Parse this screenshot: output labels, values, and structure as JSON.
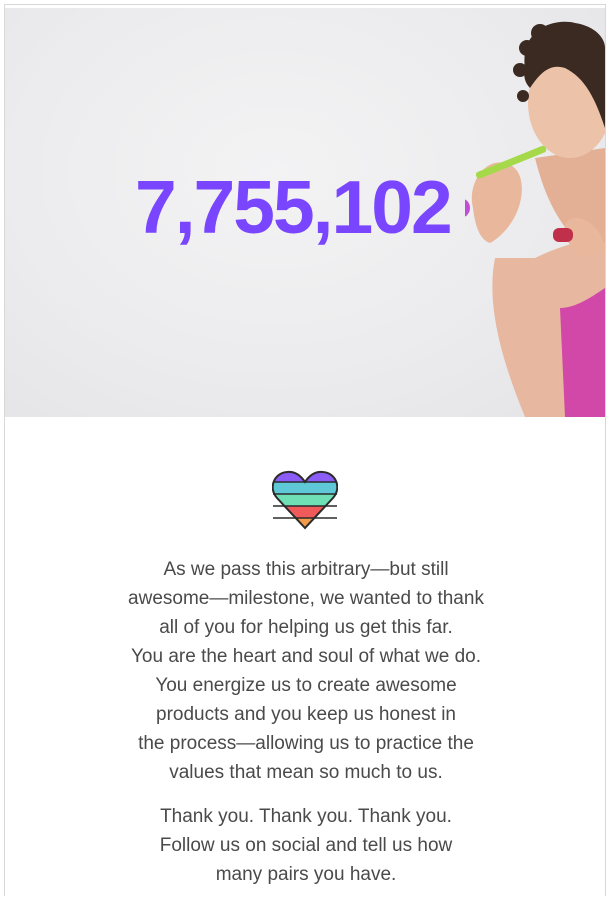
{
  "hero": {
    "counter": "7,755,102"
  },
  "heart": {
    "colors": [
      "#8b5cf6",
      "#5ec8d6",
      "#6fe0b6",
      "#f05a5a",
      "#f29b4b"
    ]
  },
  "body": {
    "paragraph1_lines": [
      "As we pass this arbitrary—but still",
      "awesome—milestone, we wanted to thank",
      "all of you for helping us get this far.",
      "You are the heart and soul of what we do.",
      "You energize us to create awesome",
      "products and you keep us honest in",
      "the process—allowing us to practice the",
      "values that mean so much to us."
    ],
    "paragraph2_lines": [
      "Thank you. Thank you. Thank you.",
      "Follow us on social and tell us how",
      "many pairs you have."
    ]
  }
}
